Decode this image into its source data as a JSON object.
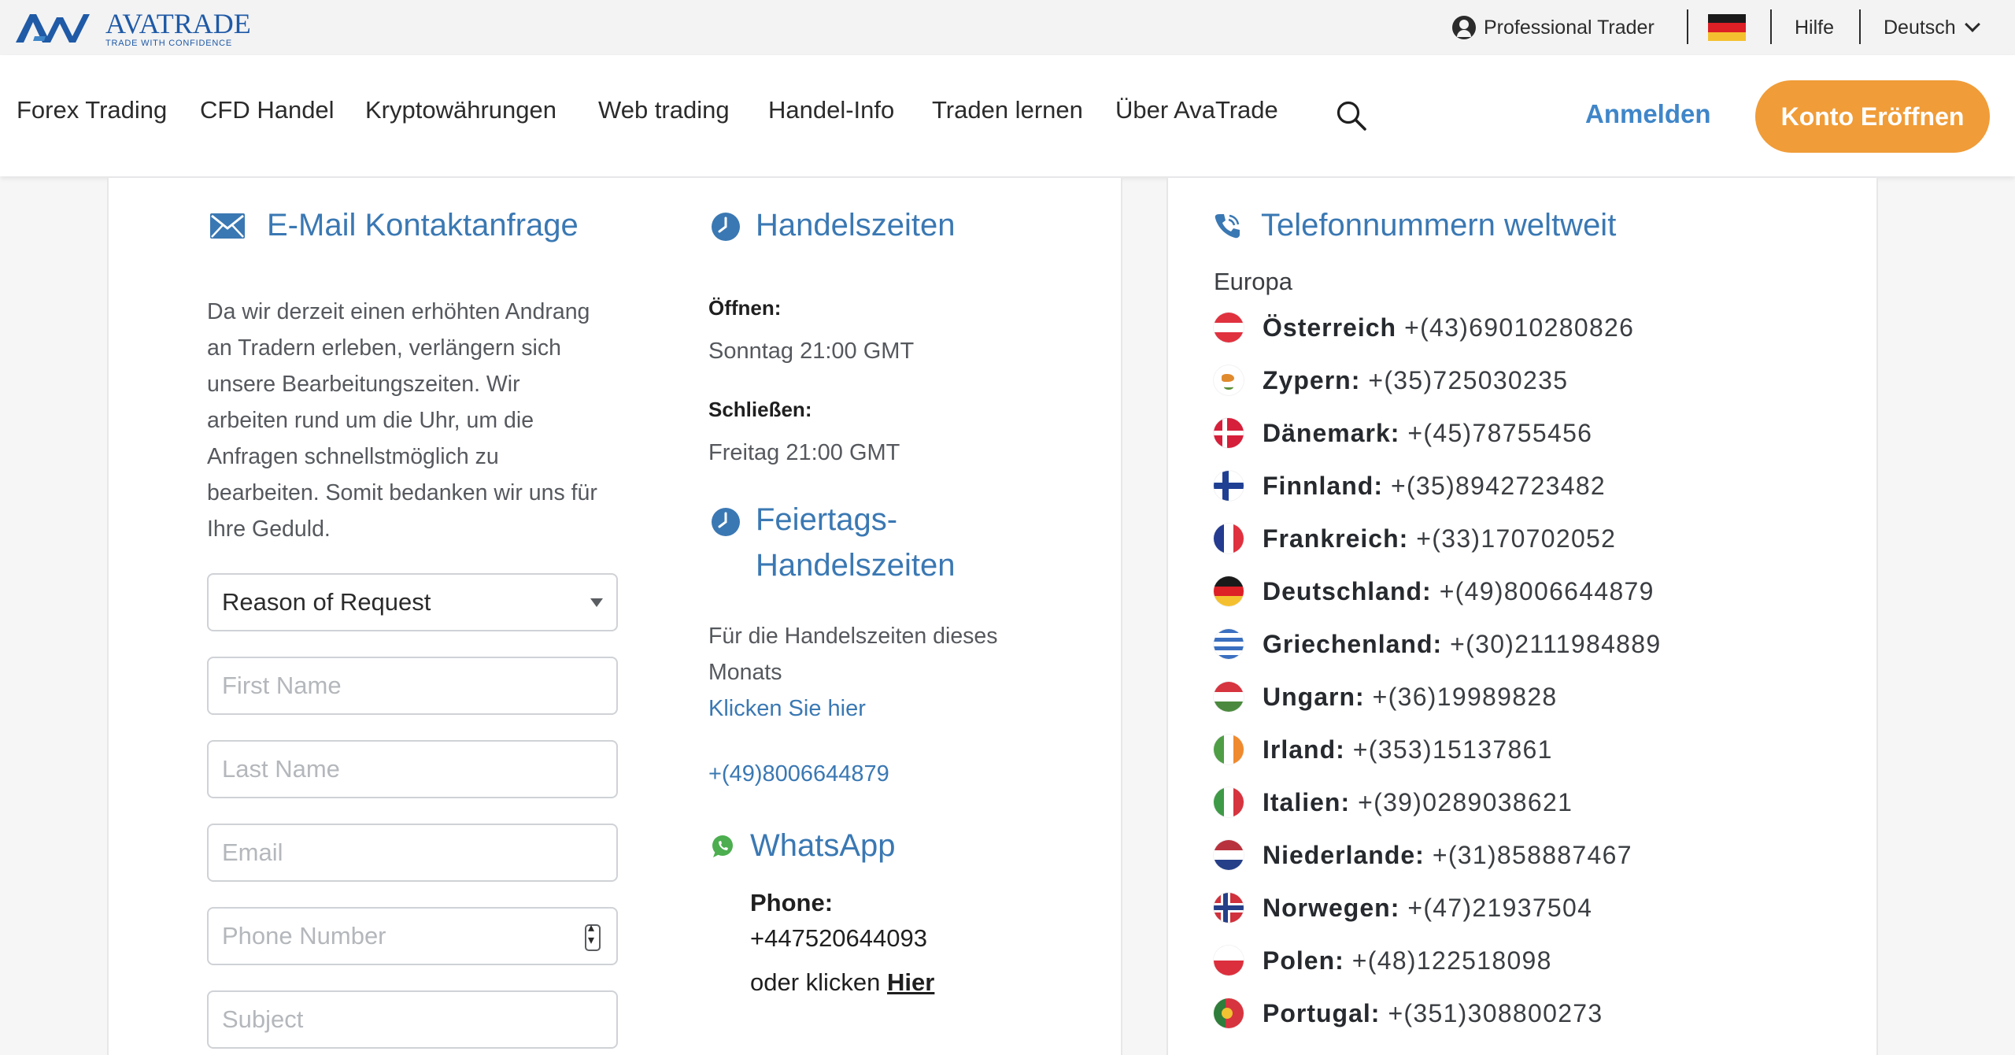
{
  "brand": {
    "name": "AVATRADE",
    "tagline": "TRADE WITH CONFIDENCE",
    "primary_color": "#1f5aa6",
    "accent_color": "#f09c38",
    "link_color": "#3a78b3"
  },
  "topbar": {
    "professional_label": "Professional Trader",
    "flag_icon": "germany-flag-icon",
    "help_label": "Hilfe",
    "language_label": "Deutsch"
  },
  "nav": {
    "items": [
      {
        "label": "Forex Trading"
      },
      {
        "label": "CFD Handel"
      },
      {
        "label": "Kryptowährungen"
      },
      {
        "label": "Web trading"
      },
      {
        "label": "Handel-Info"
      },
      {
        "label": "Traden lernen"
      },
      {
        "label": "Über AvaTrade"
      }
    ],
    "login_label": "Anmelden",
    "open_account_label": "Konto Eröffnen"
  },
  "email_section": {
    "title": "E-Mail Kontaktanfrage",
    "intro_lines": [
      "Da wir derzeit einen erhöhten Andrang",
      "an Tradern erleben, verlängern sich",
      "unsere Bearbeitungszeiten. Wir",
      "arbeiten rund um die Uhr, um die",
      "Anfragen schnellstmöglich zu",
      "bearbeiten. Somit bedanken wir uns für",
      "Ihre Geduld."
    ],
    "form": {
      "reason_selected": "Reason of Request",
      "first_name_placeholder": "First Name",
      "last_name_placeholder": "Last Name",
      "email_placeholder": "Email",
      "phone_placeholder": "Phone Number",
      "subject_placeholder": "Subject"
    }
  },
  "trading_hours": {
    "title": "Handelszeiten",
    "open_label": "Öffnen:",
    "open_value": "Sonntag 21:00 GMT",
    "close_label": "Schließen:",
    "close_value": "Freitag 21:00 GMT"
  },
  "holiday_hours": {
    "title_line1": "Feiertags-",
    "title_line2": "Handelszeiten",
    "text_line1": "Für die Handelszeiten dieses",
    "text_line2": "Monats",
    "link_label": "Klicken Sie hier",
    "phone_link": "+(49)8006644879"
  },
  "whatsapp": {
    "title": "WhatsApp",
    "phone_label": "Phone:",
    "phone_value": "+447520644093",
    "click_prefix": "oder klicken",
    "click_link": "Hier"
  },
  "phones": {
    "title": "Telefonnummern weltweit",
    "region": "Europa",
    "entries": [
      {
        "country": "Österreich",
        "number": "+(43)69010280826"
      },
      {
        "country": "Zypern:",
        "number": " +(35)725030235"
      },
      {
        "country": "Dänemark:",
        "number": "+(45)78755456"
      },
      {
        "country": "Finnland:",
        "number": "+(35)8942723482"
      },
      {
        "country": "Frankreich:",
        "number": "+(33)170702052"
      },
      {
        "country": "Deutschland:",
        "number": "+(49)8006644879"
      },
      {
        "country": "Griechenland:",
        "number": "+(30)2111984889"
      },
      {
        "country": "Ungarn:",
        "number": "+(36)19989828"
      },
      {
        "country": "Irland:",
        "number": "+(353)15137861"
      },
      {
        "country": "Italien:",
        "number": "+(39)0289038621"
      },
      {
        "country": "Niederlande:",
        "number": "+(31)858887467"
      },
      {
        "country": "Norwegen:",
        "number": "+(47)21937504"
      },
      {
        "country": "Polen:",
        "number": "+(48)122518098"
      },
      {
        "country": "Portugal:",
        "number": "+(351)308800273"
      }
    ]
  }
}
